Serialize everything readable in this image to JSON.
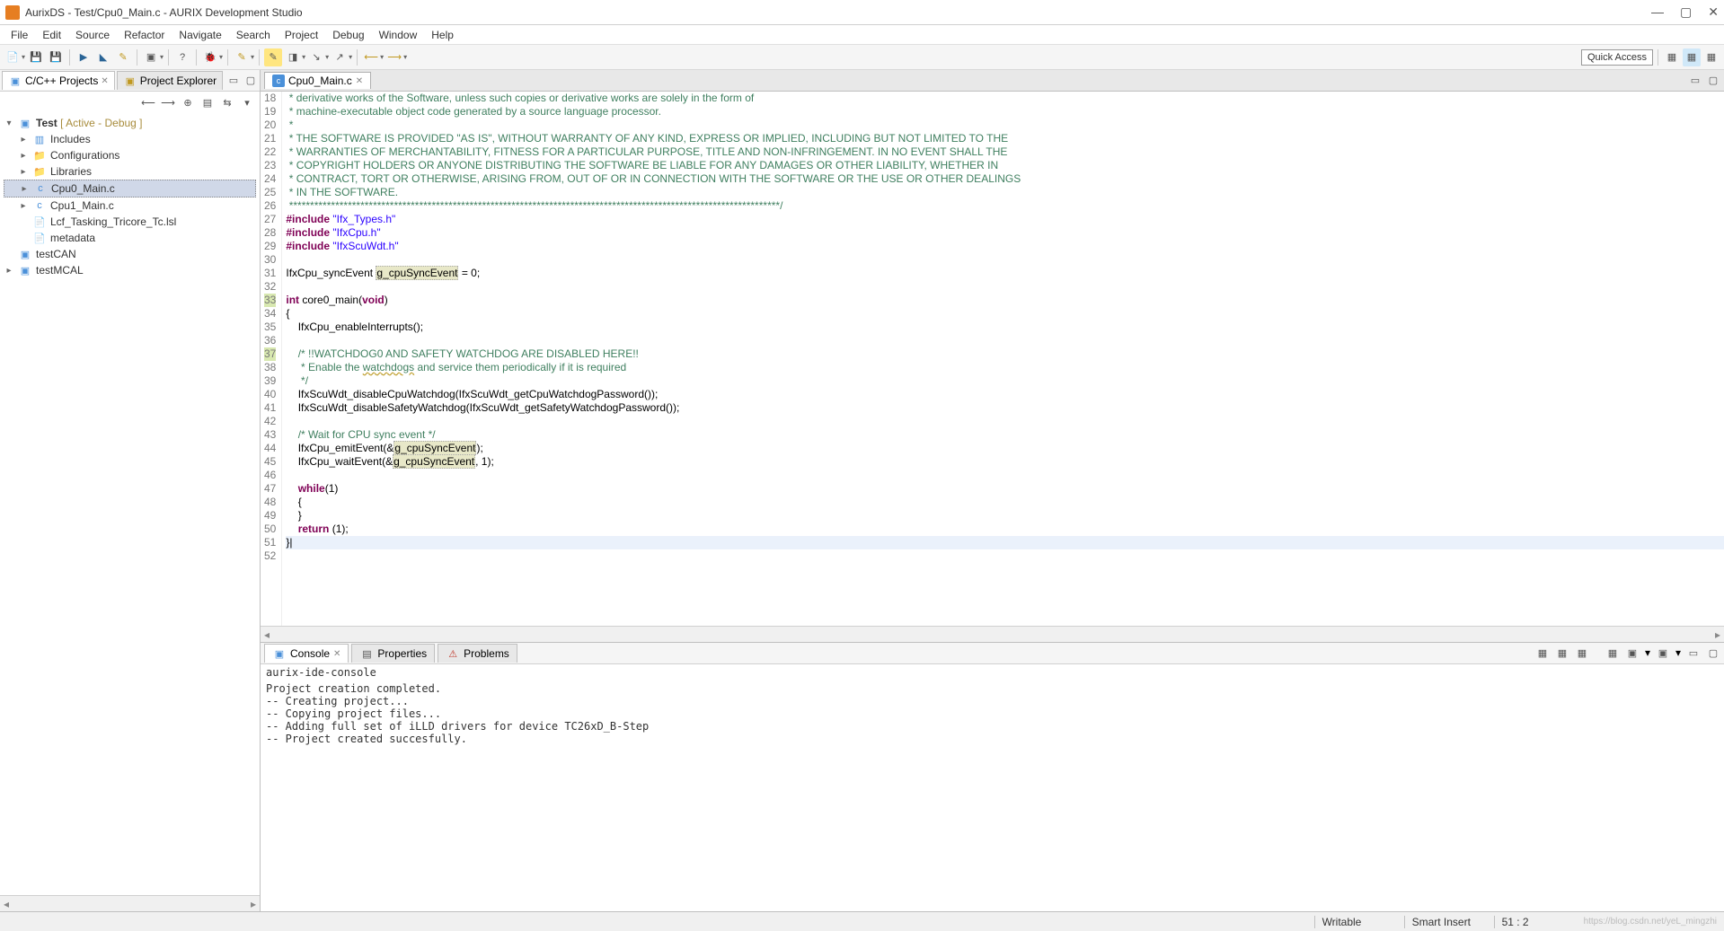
{
  "titlebar": {
    "title": "AurixDS - Test/Cpu0_Main.c - AURIX Development Studio"
  },
  "menu": {
    "items": [
      "File",
      "Edit",
      "Source",
      "Refactor",
      "Navigate",
      "Search",
      "Project",
      "Debug",
      "Window",
      "Help"
    ]
  },
  "toolbar": {
    "quick_access": "Quick Access"
  },
  "left": {
    "tab_active": "C/C++ Projects",
    "tab_inactive": "Project Explorer",
    "tree": {
      "root": "Test",
      "root_decor": "[ Active - Debug ]",
      "items": [
        "Includes",
        "Configurations",
        "Libraries",
        "Cpu0_Main.c",
        "Cpu1_Main.c",
        "Lcf_Tasking_Tricore_Tc.lsl",
        "metadata"
      ],
      "siblings": [
        "testCAN",
        "testMCAL"
      ]
    }
  },
  "editor": {
    "tab": "Cpu0_Main.c",
    "lines": [
      {
        "n": 18,
        "cls": "comment",
        "text": " * derivative works of the Software, unless such copies or derivative works are solely in the form of"
      },
      {
        "n": 19,
        "cls": "comment",
        "text": " * machine-executable object code generated by a source language processor."
      },
      {
        "n": 20,
        "cls": "comment",
        "text": " *"
      },
      {
        "n": 21,
        "cls": "comment",
        "text": " * THE SOFTWARE IS PROVIDED \"AS IS\", WITHOUT WARRANTY OF ANY KIND, EXPRESS OR IMPLIED, INCLUDING BUT NOT LIMITED TO THE"
      },
      {
        "n": 22,
        "cls": "comment",
        "text": " * WARRANTIES OF MERCHANTABILITY, FITNESS FOR A PARTICULAR PURPOSE, TITLE AND NON-INFRINGEMENT. IN NO EVENT SHALL THE"
      },
      {
        "n": 23,
        "cls": "comment",
        "text": " * COPYRIGHT HOLDERS OR ANYONE DISTRIBUTING THE SOFTWARE BE LIABLE FOR ANY DAMAGES OR OTHER LIABILITY, WHETHER IN"
      },
      {
        "n": 24,
        "cls": "comment",
        "text": " * CONTRACT, TORT OR OTHERWISE, ARISING FROM, OUT OF OR IN CONNECTION WITH THE SOFTWARE OR THE USE OR OTHER DEALINGS"
      },
      {
        "n": 25,
        "cls": "comment",
        "text": " * IN THE SOFTWARE."
      },
      {
        "n": 26,
        "cls": "comment",
        "text": " *********************************************************************************************************************/"
      },
      {
        "n": 27,
        "cls": "include",
        "text": "#include \"Ifx_Types.h\""
      },
      {
        "n": 28,
        "cls": "include",
        "text": "#include \"IfxCpu.h\""
      },
      {
        "n": 29,
        "cls": "include",
        "text": "#include \"IfxScuWdt.h\""
      },
      {
        "n": 30,
        "cls": "",
        "text": ""
      },
      {
        "n": 31,
        "cls": "decl",
        "text": "IfxCpu_syncEvent g_cpuSyncEvent = 0;"
      },
      {
        "n": 32,
        "cls": "",
        "text": ""
      },
      {
        "n": 33,
        "cls": "func",
        "text": "int core0_main(void)",
        "mark": true
      },
      {
        "n": 34,
        "cls": "",
        "text": "{"
      },
      {
        "n": 35,
        "cls": "",
        "text": "    IfxCpu_enableInterrupts();"
      },
      {
        "n": 36,
        "cls": "",
        "text": ""
      },
      {
        "n": 37,
        "cls": "comment",
        "text": "    /* !!WATCHDOG0 AND SAFETY WATCHDOG ARE DISABLED HERE!!",
        "mark": true
      },
      {
        "n": 38,
        "cls": "comment-warn",
        "text": "     * Enable the watchdogs and service them periodically if it is required"
      },
      {
        "n": 39,
        "cls": "comment",
        "text": "     */"
      },
      {
        "n": 40,
        "cls": "",
        "text": "    IfxScuWdt_disableCpuWatchdog(IfxScuWdt_getCpuWatchdogPassword());"
      },
      {
        "n": 41,
        "cls": "",
        "text": "    IfxScuWdt_disableSafetyWatchdog(IfxScuWdt_getSafetyWatchdogPassword());"
      },
      {
        "n": 42,
        "cls": "",
        "text": ""
      },
      {
        "n": 43,
        "cls": "comment",
        "text": "    /* Wait for CPU sync event */"
      },
      {
        "n": 44,
        "cls": "hlvar",
        "text": "    IfxCpu_emitEvent(&g_cpuSyncEvent);"
      },
      {
        "n": 45,
        "cls": "hlvar",
        "text": "    IfxCpu_waitEvent(&g_cpuSyncEvent, 1);"
      },
      {
        "n": 46,
        "cls": "",
        "text": ""
      },
      {
        "n": 47,
        "cls": "keyword",
        "text": "    while(1)"
      },
      {
        "n": 48,
        "cls": "",
        "text": "    {"
      },
      {
        "n": 49,
        "cls": "",
        "text": "    }"
      },
      {
        "n": 50,
        "cls": "keyword",
        "text": "    return (1);"
      },
      {
        "n": 51,
        "cls": "highlight",
        "text": "}|"
      },
      {
        "n": 52,
        "cls": "",
        "text": ""
      }
    ]
  },
  "bottom": {
    "tab_console": "Console",
    "tab_properties": "Properties",
    "tab_problems": "Problems",
    "console_title": "aurix-ide-console",
    "console_lines": [
      "Project creation completed.",
      "-- Creating project...",
      "-- Copying project files...",
      "-- Adding full set of iLLD drivers for device TC26xD_B-Step",
      "-- Project created succesfully."
    ]
  },
  "status": {
    "writable": "Writable",
    "insert": "Smart Insert",
    "position": "51 : 2",
    "watermark": "https://blog.csdn.net/yeL_mingzhi"
  }
}
